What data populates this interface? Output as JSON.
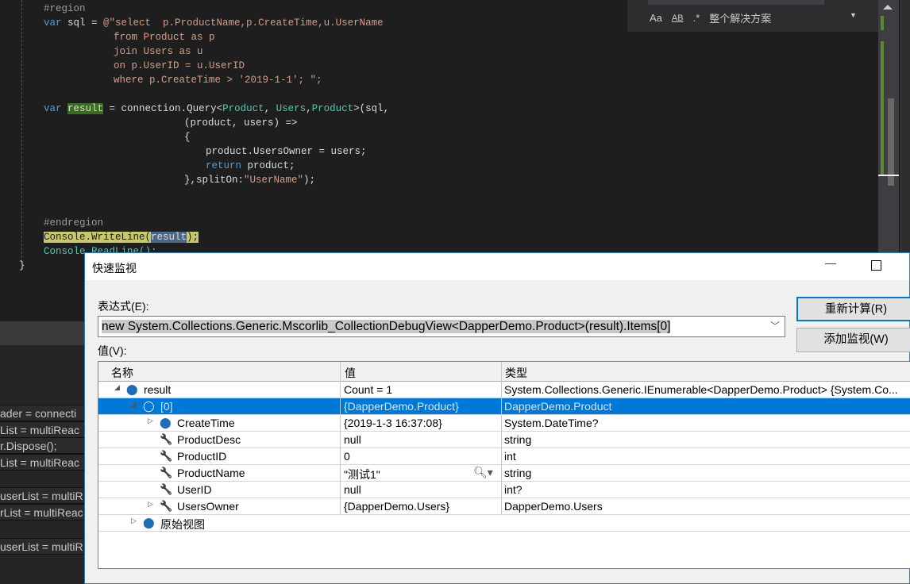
{
  "code": {
    "l1": "#region",
    "l2a": "var",
    "l2b": " sql = ",
    "l2c": "@\"select  p.ProductName,p.CreateTime,u.UserName",
    "l3": "from Product as p",
    "l4": "join Users as u",
    "l5": "on p.UserID = u.UserID",
    "l6": "where p.CreateTime > '2019-1-1'; \";",
    "l7a": "var",
    "l7b": "result",
    "l7c": " = connection.Query<",
    "l7d": "Product",
    "l7e": ", ",
    "l7f": "Users",
    "l7g": ",",
    "l7h": "Product",
    "l7i": ">(sql,",
    "l8": "(product, users) =>",
    "l9": "{",
    "l10": "product.UsersOwner = users;",
    "l11a": "return",
    "l11b": " product;",
    "l12a": "},splitOn:",
    "l12b": "\"UserName\"",
    "l12c": ");",
    "l13": "#endregion",
    "l14a": "Console.WriteLine(",
    "l14b": "result",
    "l14c": ");",
    "l15": "Console.ReadLine();",
    "l16": "}"
  },
  "find": {
    "match_case": "Aa",
    "whole_word": "AB",
    "regex": ".*",
    "scope": "整个解决方案"
  },
  "lower_panel": [
    "ader = connecti",
    "List = multiReac",
    "r.Dispose();",
    "List = multiReac",
    "userList = multiR",
    "rList = multiReac",
    "userList = multiR"
  ],
  "dialog": {
    "title": "快速监视",
    "expression_label": "表达式(E):",
    "expression": "new System.Collections.Generic.Mscorlib_CollectionDebugView<DapperDemo.Product>(result).Items[0]",
    "reevaluate": "重新计算(R)",
    "add_watch": "添加监视(W)",
    "value_label": "值(V):",
    "columns": [
      "名称",
      "值",
      "类型"
    ],
    "rows": [
      {
        "name": "result",
        "value": "Count = 1",
        "type": "System.Collections.Generic.IEnumerable<DapperDemo.Product> {System.Co..."
      },
      {
        "name": "[0]",
        "value": "{DapperDemo.Product}",
        "type": "DapperDemo.Product"
      },
      {
        "name": "CreateTime",
        "value": "{2019-1-3 16:37:08}",
        "type": "System.DateTime?"
      },
      {
        "name": "ProductDesc",
        "value": "null",
        "type": "string"
      },
      {
        "name": "ProductID",
        "value": "0",
        "type": "int"
      },
      {
        "name": "ProductName",
        "value": "\"测试1\"",
        "type": "string"
      },
      {
        "name": "UserID",
        "value": "null",
        "type": "int?"
      },
      {
        "name": "UsersOwner",
        "value": "{DapperDemo.Users}",
        "type": "DapperDemo.Users"
      },
      {
        "name": "原始视图",
        "value": "",
        "type": ""
      }
    ]
  },
  "colors": {
    "editor_bg": "#1e1e1e",
    "keyword": "#569cd6",
    "string": "#d69d85",
    "type": "#4ec9b0",
    "selection": "#0078d7"
  }
}
